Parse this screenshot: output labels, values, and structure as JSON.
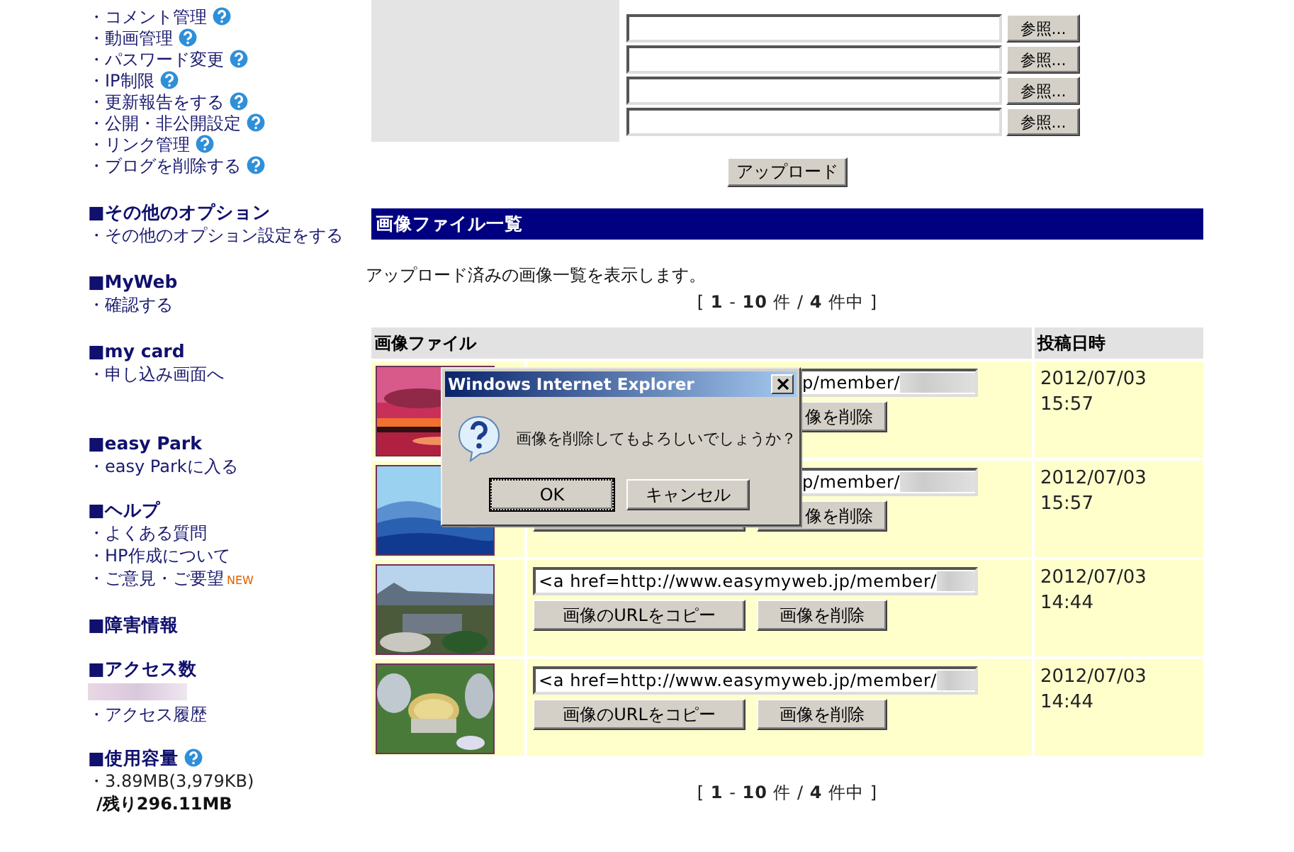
{
  "sidebar": {
    "top_items": [
      {
        "label": "・コメント管理",
        "help": true
      },
      {
        "label": "・動画管理",
        "help": true
      },
      {
        "label": "・パスワード変更",
        "help": true
      },
      {
        "label": "・IP制限",
        "help": true
      },
      {
        "label": "・更新報告をする",
        "help": true
      },
      {
        "label": "・公開・非公開設定",
        "help": true
      },
      {
        "label": "・リンク管理",
        "help": true
      },
      {
        "label": "・ブログを削除する",
        "help": true
      }
    ],
    "sections": [
      {
        "title": "■その他のオプション",
        "items": [
          {
            "kind": "link",
            "label": "・その他のオプション設定をする"
          }
        ]
      },
      {
        "title": "■MyWeb",
        "items": [
          {
            "kind": "link",
            "label": "・確認する"
          }
        ]
      },
      {
        "title": "■my card",
        "items": [
          {
            "kind": "link",
            "label": "・申し込み画面へ"
          }
        ]
      },
      {
        "title": "■easy Park",
        "items": [
          {
            "kind": "link",
            "label": "・easy Parkに入る"
          }
        ]
      },
      {
        "title": "■ヘルプ",
        "items": [
          {
            "kind": "link",
            "label": "・よくある質問"
          },
          {
            "kind": "link",
            "label": "・HP作成について"
          },
          {
            "kind": "link",
            "label": "・ご意見・ご要望",
            "badge": "NEW"
          }
        ]
      },
      {
        "title": "■障害情報"
      },
      {
        "title": "■アクセス数",
        "items": [
          {
            "kind": "redacted"
          },
          {
            "kind": "link",
            "label": "・アクセス履歴"
          }
        ]
      },
      {
        "title": "■使用容量",
        "help": true,
        "items": [
          {
            "kind": "text",
            "label": "・3.89MB(3,979KB)"
          },
          {
            "kind": "bold",
            "label": "/残り296.11MB"
          }
        ]
      }
    ]
  },
  "upload": {
    "browse_buttons": [
      "参照...",
      "参照...",
      "参照...",
      "参照..."
    ],
    "submit": "アップロード"
  },
  "image_list": {
    "title": "画像ファイル一覧",
    "description": "アップロード済みの画像一覧を表示します。",
    "pager_top": "[ **1** - **10** 件 / **4** 件中 ]",
    "columns": [
      "画像ファイル",
      "投稿日時"
    ],
    "rows": [
      {
        "kind": "covered",
        "url": "p/member/",
        "delete_label": "像を削除",
        "date": "2012/07/03",
        "time": "15:57"
      },
      {
        "kind": "half-covered",
        "url": "p/member/",
        "delete_label": "像を削除",
        "date": "2012/07/03",
        "time": "15:57"
      },
      {
        "kind": "full",
        "url": "<a href=http://www.easymyweb.jp/member/",
        "copy_label": "画像のURLをコピー",
        "delete_label": "画像を削除",
        "date": "2012/07/03",
        "time": "14:44"
      },
      {
        "kind": "full",
        "url": "<a href=http://www.easymyweb.jp/member/",
        "copy_label": "画像のURLをコピー",
        "delete_label": "画像を削除",
        "date": "2012/07/03",
        "time": "14:44"
      }
    ],
    "pager_bottom": "[ **1** - **10** 件 / **4** 件中 ]"
  },
  "dialog": {
    "title": "Windows Internet Explorer",
    "message": "画像を削除してもよろしいでしょうか？",
    "buttons": [
      "OK",
      "キャンセル"
    ]
  }
}
